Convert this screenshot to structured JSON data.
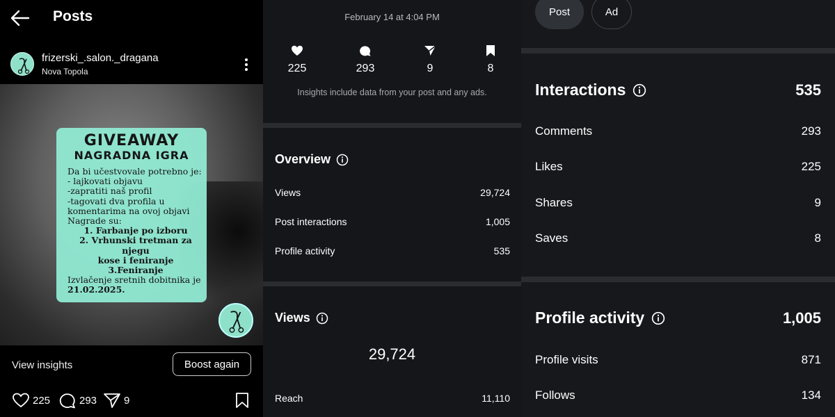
{
  "header": {
    "title": "Posts"
  },
  "post": {
    "account": "frizerski_.salon._dragana",
    "location": "Nova Topola",
    "image": {
      "title": "GIVEAWAY",
      "subtitle": "NAGRADNA IGRA",
      "lines": [
        "Da bi učestvovale potrebno je:",
        "- lajkovati objavu",
        "-zapratiti naš profil",
        "-tagovati dva profila u",
        "komentarima na ovoj objavi",
        "Nagrade su:"
      ],
      "prizes": [
        "1. Farbanje po izboru",
        "2. Vrhunski tretman za njegu",
        "kose i feniranje",
        "3.Feniranje"
      ],
      "footer": "Izvlačenje sretnih dobitnika je",
      "date": "21.02.2025."
    },
    "view_insights": "View insights",
    "boost_label": "Boost again",
    "likes": "225",
    "comments": "293",
    "shares": "9"
  },
  "insights": {
    "date": "February 14 at 4:04 PM",
    "stats": {
      "likes": "225",
      "comments": "293",
      "shares": "9",
      "saves": "8"
    },
    "note": "Insights include data from your post and any ads.",
    "overview": {
      "title": "Overview",
      "rows": [
        {
          "label": "Views",
          "value": "29,724"
        },
        {
          "label": "Post interactions",
          "value": "1,005"
        },
        {
          "label": "Profile activity",
          "value": "535"
        }
      ]
    },
    "views": {
      "title": "Views",
      "total": "29,724",
      "reach_label": "Reach",
      "reach_value": "11,110"
    }
  },
  "detail": {
    "tabs": [
      "Post",
      "Ad"
    ],
    "interactions": {
      "title": "Interactions",
      "total": "535",
      "rows": [
        {
          "label": "Comments",
          "value": "293"
        },
        {
          "label": "Likes",
          "value": "225"
        },
        {
          "label": "Shares",
          "value": "9"
        },
        {
          "label": "Saves",
          "value": "8"
        }
      ]
    },
    "profile_activity": {
      "title": "Profile activity",
      "total": "1,005",
      "rows": [
        {
          "label": "Profile visits",
          "value": "871"
        },
        {
          "label": "Follows",
          "value": "134"
        }
      ]
    }
  },
  "colors": {
    "card": "#91ead3",
    "panel": "#14161a",
    "divider": "#2a2c30"
  },
  "icons": [
    "back-arrow-icon",
    "more-vertical-icon",
    "heart-icon",
    "comment-icon",
    "share-icon",
    "bookmark-icon",
    "info-icon"
  ]
}
